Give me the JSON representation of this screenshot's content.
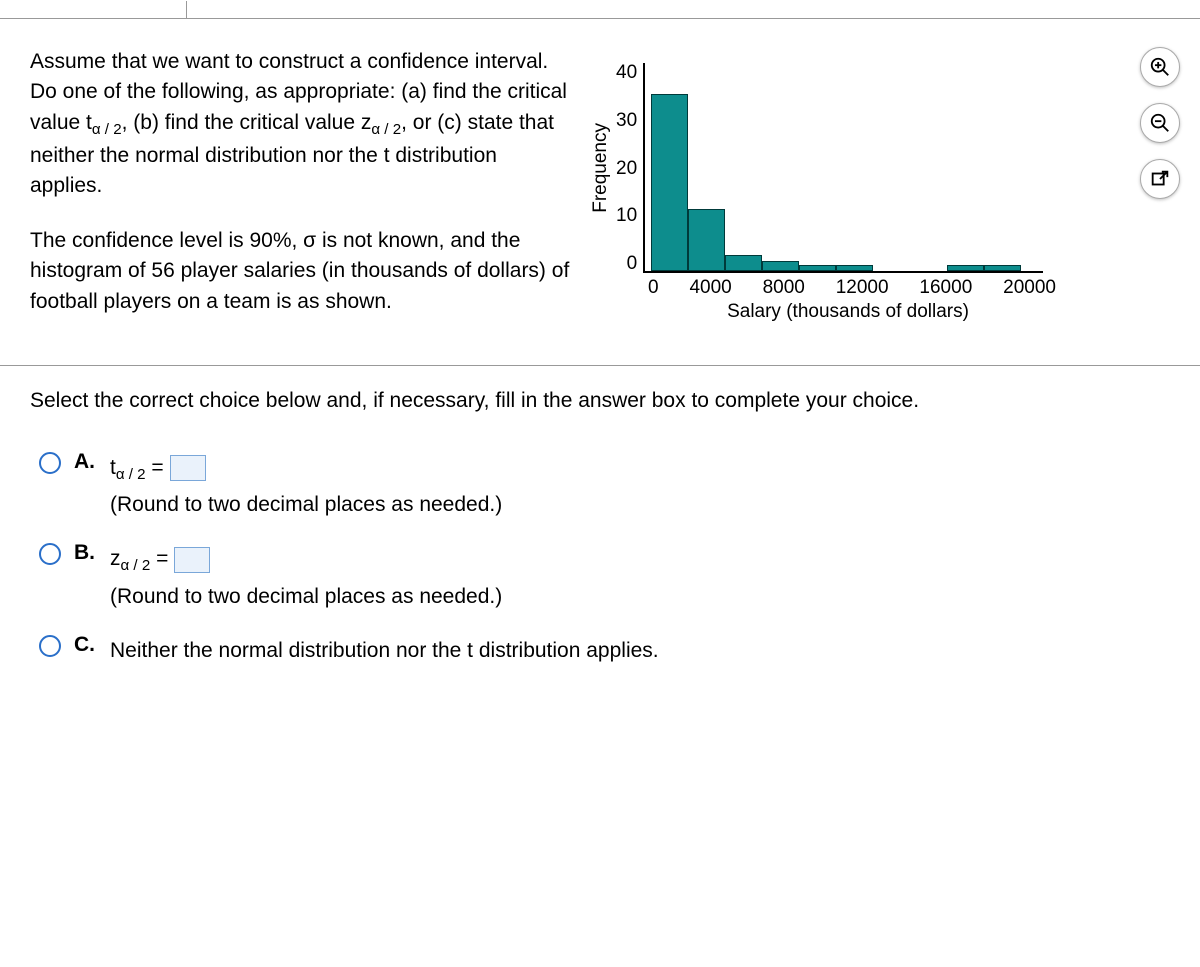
{
  "problem": {
    "para1_a": "Assume that we want to construct a confidence interval. Do one of the following, as appropriate: (a) find the critical value t",
    "para1_b": ", (b) find the critical value z",
    "para1_c": ", or (c) state that neither the normal distribution nor the t distribution applies.",
    "para2": "The confidence level is 90%, σ is not known, and the histogram of 56 player salaries (in thousands of dollars) of football players on a team is as shown.",
    "alpha_sub": "α / 2"
  },
  "chart_data": {
    "type": "bar",
    "ylabel": "Frequency",
    "xlabel": "Salary (thousands of dollars)",
    "yticks": [
      "40",
      "30",
      "20",
      "10",
      "0"
    ],
    "xticks": [
      "0",
      "4000",
      "8000",
      "12000",
      "16000",
      "20000"
    ],
    "ylim": [
      0,
      40
    ],
    "categories": [
      "0-2000",
      "2000-4000",
      "4000-6000",
      "6000-8000",
      "8000-10000",
      "10000-12000",
      "12000-14000",
      "14000-16000",
      "16000-18000",
      "18000-20000"
    ],
    "values": [
      34,
      12,
      3,
      2,
      1,
      1,
      0,
      0,
      1,
      1
    ]
  },
  "prompt": "Select the correct choice below and, if necessary, fill in the answer box to complete your choice.",
  "choices": {
    "a": {
      "letter": "A.",
      "prefix": "t",
      "suffix": " = ",
      "hint": "(Round to two decimal places as needed.)"
    },
    "b": {
      "letter": "B.",
      "prefix": "z",
      "suffix": " = ",
      "hint": "(Round to two decimal places as needed.)"
    },
    "c": {
      "letter": "C.",
      "text": "Neither the normal distribution nor the t distribution applies."
    }
  },
  "tools": {
    "zoom_in": "zoom-in",
    "zoom_out": "zoom-out",
    "popout": "open-new-window"
  }
}
